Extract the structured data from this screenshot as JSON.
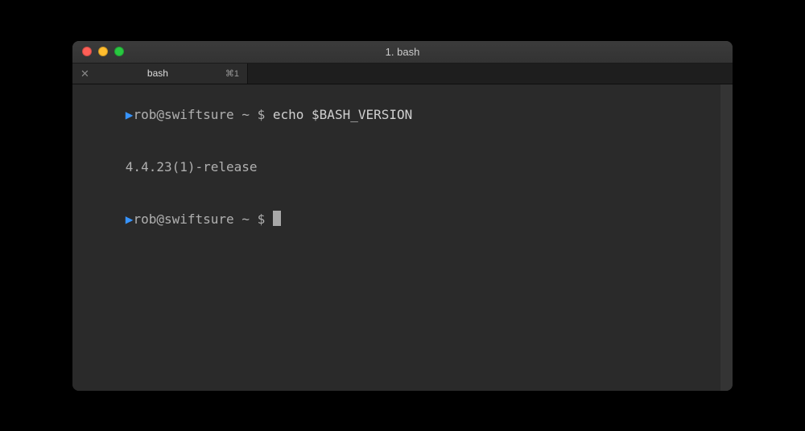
{
  "titlebar": {
    "title": "1. bash"
  },
  "tabs": [
    {
      "close_glyph": "✕",
      "label": "bash",
      "shortcut": "⌘1"
    }
  ],
  "terminal": {
    "lines": [
      {
        "indicator": "▶",
        "user_host": "rob@swiftsure",
        "path": "~",
        "dollar": "$",
        "command": "echo $BASH_VERSION"
      },
      {
        "output": "4.4.23(1)-release"
      },
      {
        "indicator": "▶",
        "user_host": "rob@swiftsure",
        "path": "~",
        "dollar": "$",
        "cursor": true
      }
    ]
  }
}
